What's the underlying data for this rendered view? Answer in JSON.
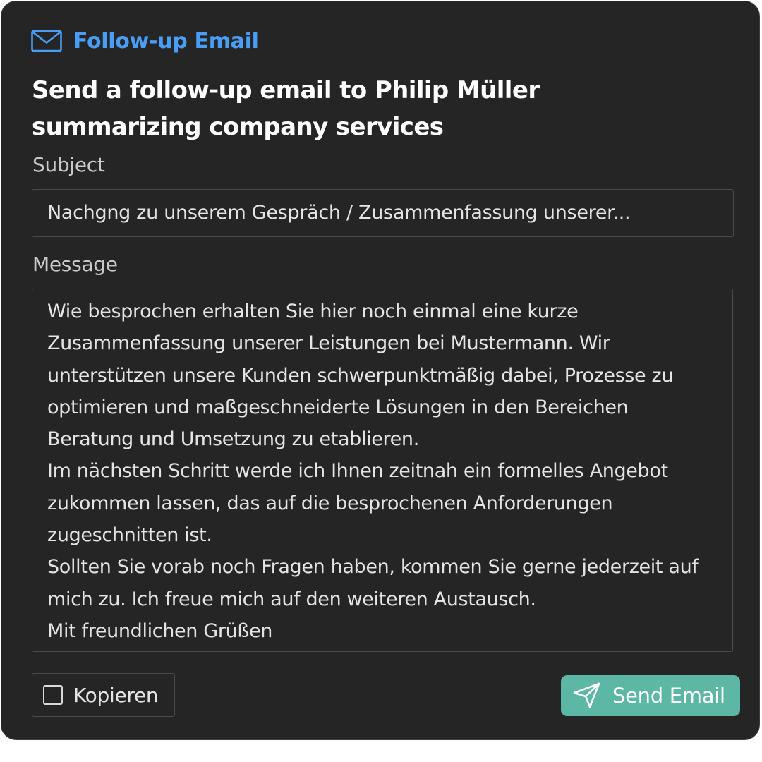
{
  "card": {
    "title": "Follow-up Email",
    "heading": "Send a follow-up email to Philip Müller summarizing company services"
  },
  "form": {
    "subject_label": "Subject",
    "subject_value": "Nachgng zu unserem Gespräch / Zusammenfassung unserer...",
    "message_label": "Message",
    "message_paragraphs": [
      "Wie besprochen erhalten Sie hier noch einmal eine kurze Zusammenfassung unserer Leistungen bei Mustermann. Wir unterstützen unsere Kunden schwerpunktmäßig dabei, Prozesse zu optimieren und maßgeschneiderte Lösungen in den Bereichen Beratung und Umsetzung zu etablieren.",
      "Im nächsten Schritt werde ich Ihnen zeitnah ein formelles Angebot zukommen lassen, das auf die besprochenen Anforderungen zugeschnitten ist.",
      "Sollten Sie vorab noch Fragen haben, kommen Sie gerne jederzeit auf mich zu. Ich freue mich auf den weiteren Austausch.",
      "Mit freundlichen Grüßen"
    ]
  },
  "actions": {
    "copy_label": "Kopieren",
    "copy_checked": false,
    "send_label": "Send Email"
  },
  "icons": {
    "header": "mail-icon",
    "send": "send-icon",
    "copy": "checkbox"
  },
  "colors": {
    "card_background": "#252525",
    "accent_blue": "#4a9df5",
    "send_button": "#5cb8a4",
    "field_border": "#4a4a4a"
  }
}
